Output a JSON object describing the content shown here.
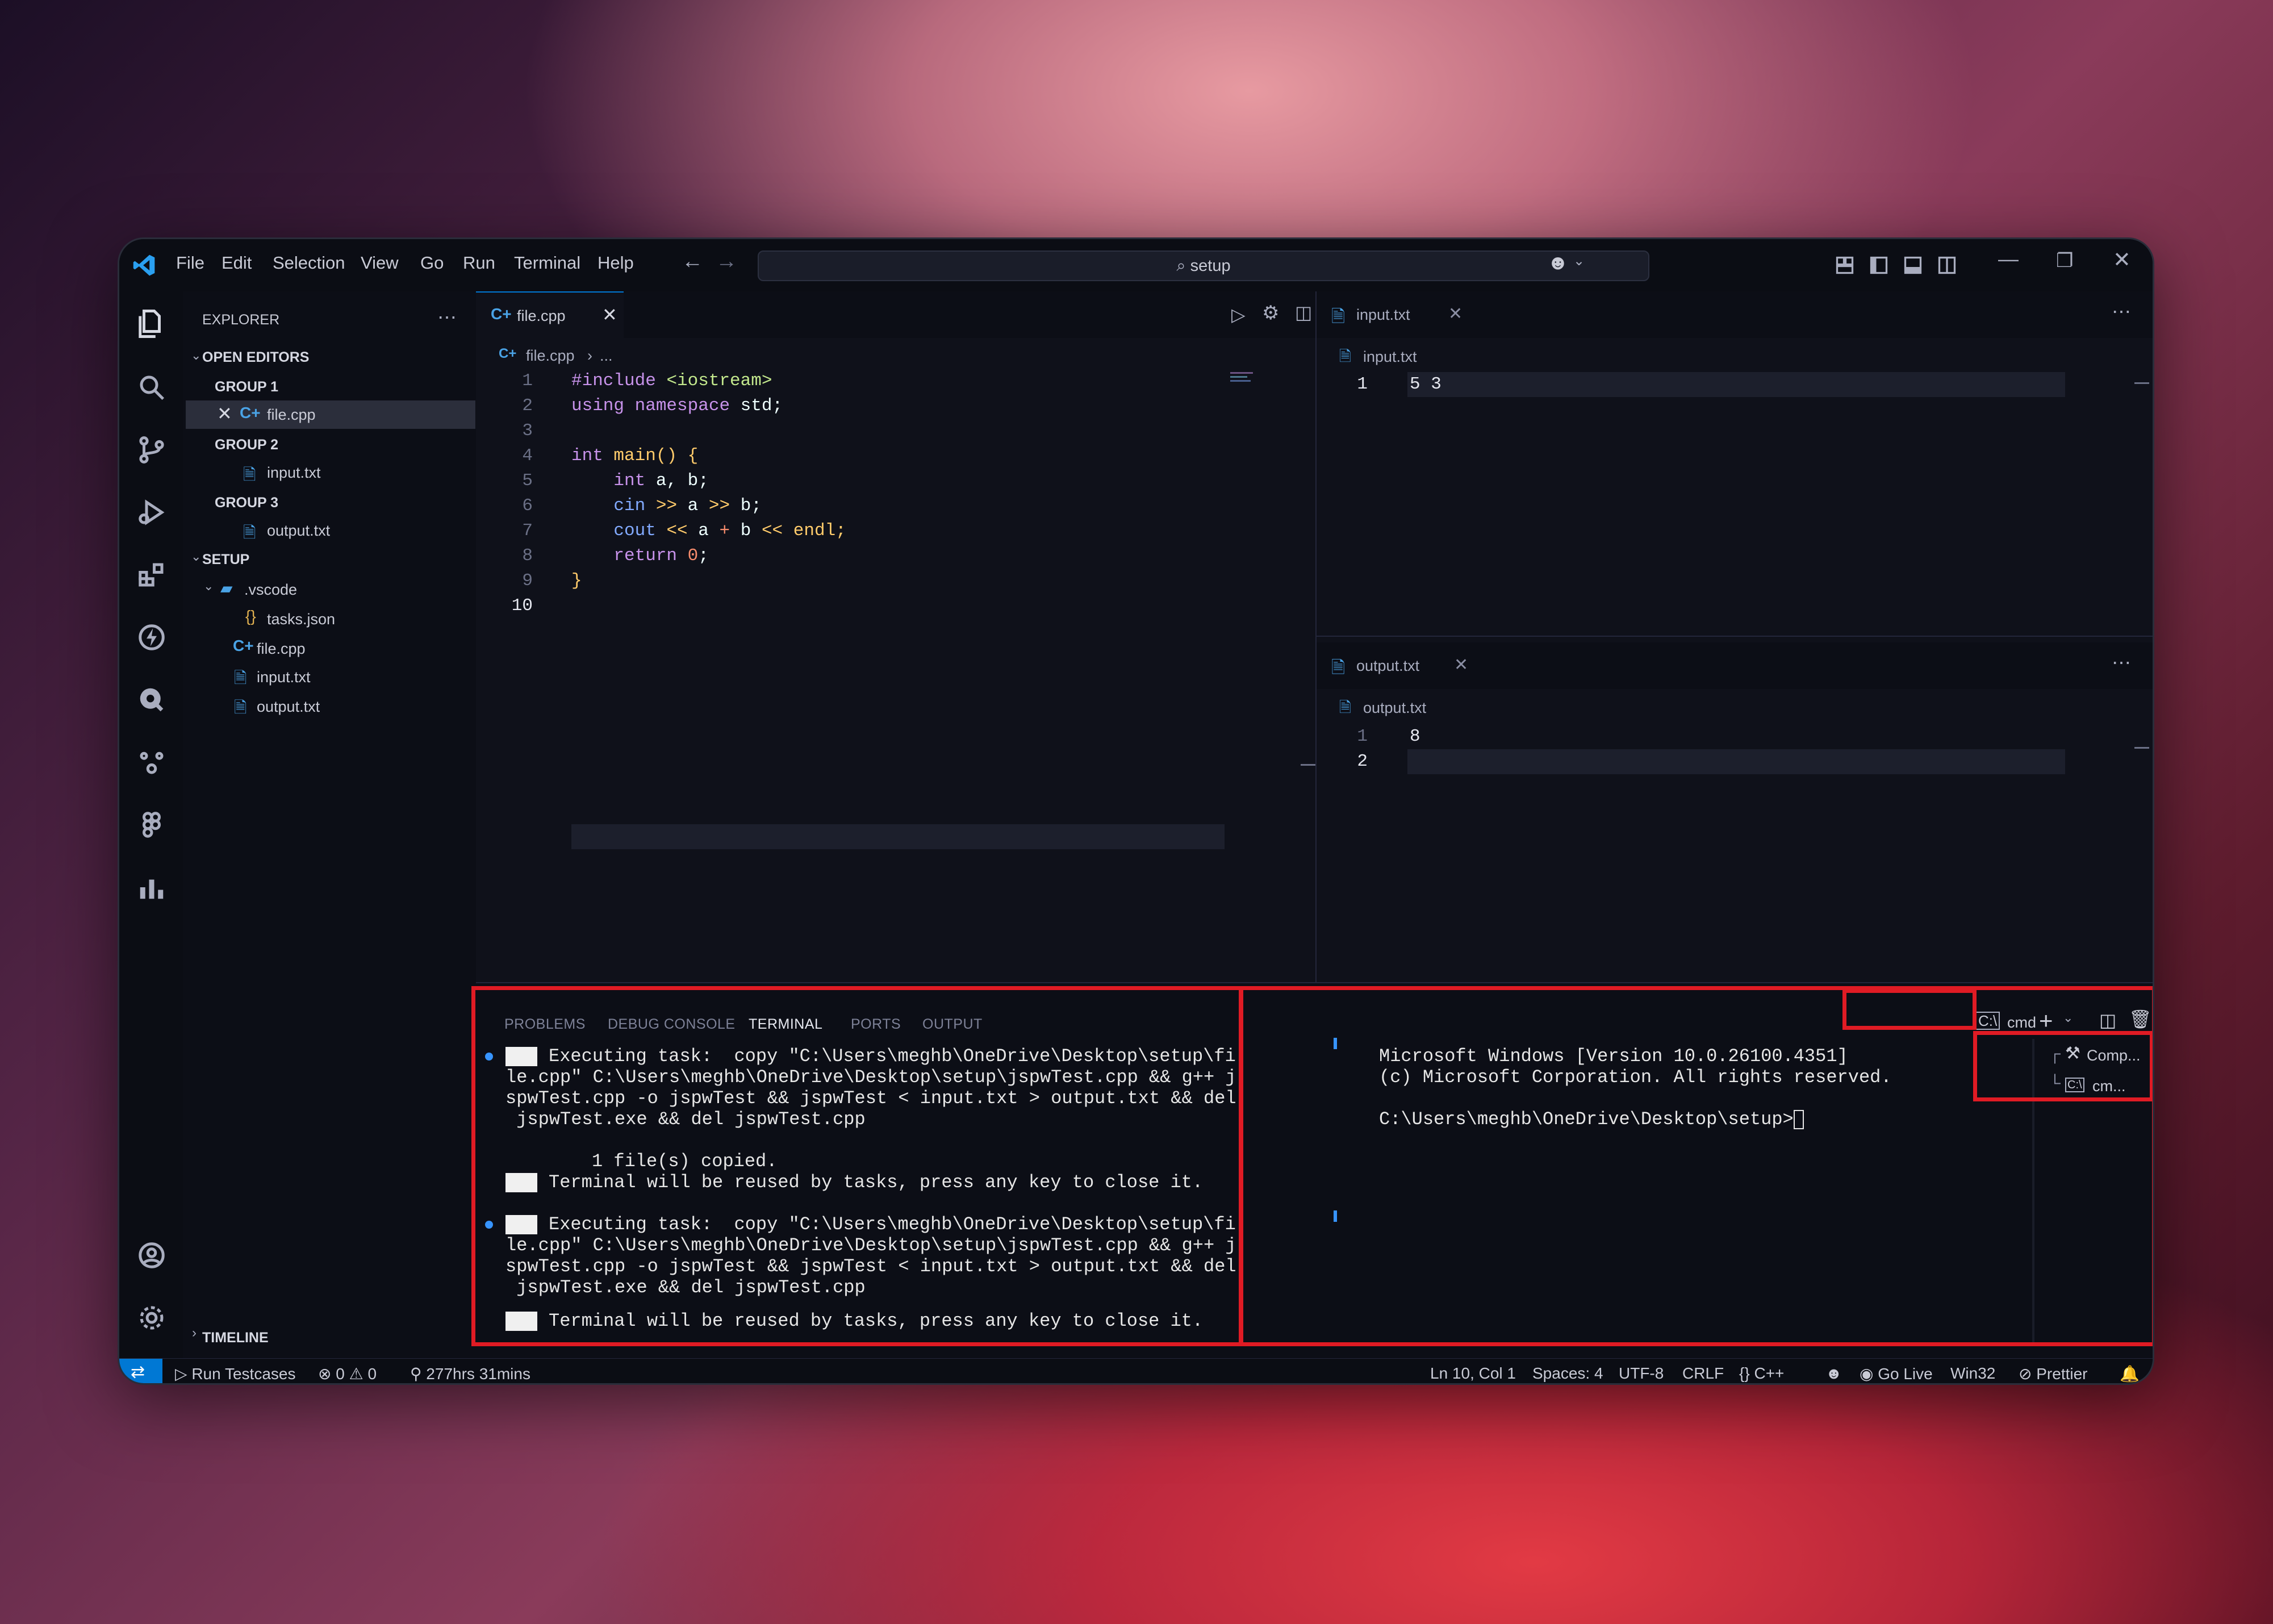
{
  "window": {
    "menu": [
      "File",
      "Edit",
      "Selection",
      "View",
      "Go",
      "Run",
      "Terminal",
      "Help"
    ],
    "search_text": "setup"
  },
  "sidebar": {
    "title": "EXPLORER",
    "open_editors_label": "OPEN EDITORS",
    "groups": [
      {
        "label": "GROUP 1",
        "file": "file.cpp"
      },
      {
        "label": "GROUP 2",
        "file": "input.txt"
      },
      {
        "label": "GROUP 3",
        "file": "output.txt"
      }
    ],
    "folder_label": "SETUP",
    "tree": {
      "vscode_folder": ".vscode",
      "tasks": "tasks.json",
      "files": [
        "file.cpp",
        "input.txt",
        "output.txt"
      ]
    },
    "timeline_label": "TIMELINE"
  },
  "editor_main": {
    "tab": "file.cpp",
    "breadcrumb": [
      "file.cpp",
      "..."
    ],
    "line_numbers": [
      "1",
      "2",
      "3",
      "4",
      "5",
      "6",
      "7",
      "8",
      "9",
      "10"
    ],
    "code": {
      "l1a": "#include",
      "l1b": "<iostream>",
      "l2a": "using",
      "l2b": "namespace",
      "l2c": "std;",
      "l4a": "int",
      "l4b": "main",
      "l4c": "()",
      "l4d": "{",
      "l5a": "int",
      "l5b": "a, b;",
      "l6a": "cin",
      "l6b": ">>",
      "l6c": "a",
      "l6d": ">>",
      "l6e": "b;",
      "l7a": "cout",
      "l7b": "<<",
      "l7c": "a",
      "l7d": "+",
      "l7e": "b",
      "l7f": "<<",
      "l7g": "endl;",
      "l8a": "return",
      "l8b": "0",
      "l8c": ";",
      "l9a": "}"
    }
  },
  "editor_input": {
    "tab": "input.txt",
    "breadcrumb": "input.txt",
    "line_number": "1",
    "content": "5 3"
  },
  "editor_output": {
    "tab": "output.txt",
    "breadcrumb": "output.txt",
    "line_numbers": [
      "1",
      "2"
    ],
    "content": "8"
  },
  "panel": {
    "tabs": [
      "PROBLEMS",
      "DEBUG CONSOLE",
      "TERMINAL",
      "PORTS",
      "OUTPUT"
    ],
    "active_tab": "TERMINAL",
    "task_block_1": {
      "exec": "Executing task:  copy \"C:\\Users\\meghb\\OneDrive\\Desktop\\setup\\fi",
      "l2": "le.cpp\" C:\\Users\\meghb\\OneDrive\\Desktop\\setup\\jspwTest.cpp && g++ j",
      "l3": "spwTest.cpp -o jspwTest && jspwTest < input.txt > output.txt && del",
      "l4": " jspwTest.exe && del jspwTest.cpp",
      "copied": "1 file(s) copied.",
      "reuse": "Terminal will be reused by tasks, press any key to close it."
    },
    "task_block_2": {
      "exec": "Executing task:  copy \"C:\\Users\\meghb\\OneDrive\\Desktop\\setup\\fi",
      "l2": "le.cpp\" C:\\Users\\meghb\\OneDrive\\Desktop\\setup\\jspwTest.cpp && g++ j",
      "l3": "spwTest.cpp -o jspwTest && jspwTest < input.txt > output.txt && del",
      "l4": " jspwTest.exe && del jspwTest.cpp",
      "reuse": "Terminal will be reused by tasks, press any key to close it."
    },
    "cmd_terminal": {
      "l1": "Microsoft Windows [Version 10.0.26100.4351]",
      "l2": "(c) Microsoft Corporation. All rights reserved.",
      "prompt": "C:\\Users\\meghb\\OneDrive\\Desktop\\setup>"
    },
    "terminal_dropdown_label": "cmd",
    "terminal_list": [
      {
        "label": "Comp...",
        "icon": "tools-icon"
      },
      {
        "label": "cm...",
        "icon": "terminal-cmd-icon"
      }
    ]
  },
  "statusbar": {
    "run_testcases": "Run Testcases",
    "errors": "0",
    "warnings": "0",
    "time": "277hrs 31mins",
    "position": "Ln 10, Col 1",
    "spaces": "Spaces: 4",
    "encoding": "UTF-8",
    "eol": "CRLF",
    "language": "C++",
    "go_live": "Go Live",
    "platform": "Win32",
    "prettier": "Prettier"
  },
  "colors": {
    "highlight_red": "#e01b24",
    "accent_blue": "#0078d4",
    "editor_bg": "#0f111a"
  }
}
